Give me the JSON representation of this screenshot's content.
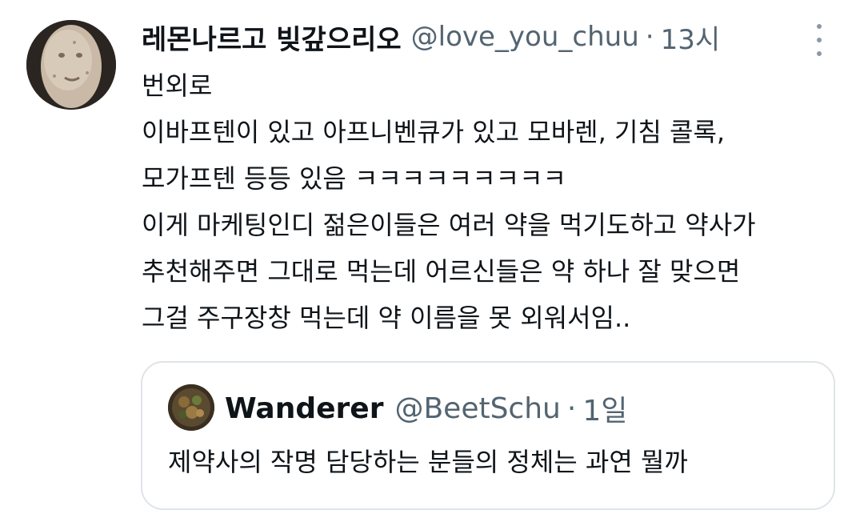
{
  "tweet": {
    "display_name": "레몬나르고 빚갚으리오",
    "handle": "@love_you_chuu",
    "separator": "·",
    "time": "13시",
    "avatar_icon": "potato-face-avatar",
    "more_icon": "vertical-ellipsis-icon",
    "lines": [
      "번외로",
      "이바프텐이 있고 아프니벤큐가 있고 모바렌, 기침 콜록,",
      "모가프텐 등등 있음 ㅋㅋㅋㅋㅋㅋㅋㅋㅋ",
      "이게 마케팅인디 젊은이들은 여러 약을 먹기도하고 약사가",
      "추천해주면 그대로 먹는데 어르신들은 약 하나 잘 맞으면",
      "그걸 주구장창 먹는데 약 이름을 못 외워서임.."
    ]
  },
  "quote": {
    "display_name": "Wanderer",
    "handle": "@BeetSchu",
    "separator": "·",
    "time": "1일",
    "avatar_icon": "food-plate-avatar",
    "text": "제약사의 작명 담당하는 분들의 정체는 과연 뭘까"
  },
  "colors": {
    "text_primary": "#0f1419",
    "text_secondary": "#536471",
    "border": "#dfe4e8"
  }
}
